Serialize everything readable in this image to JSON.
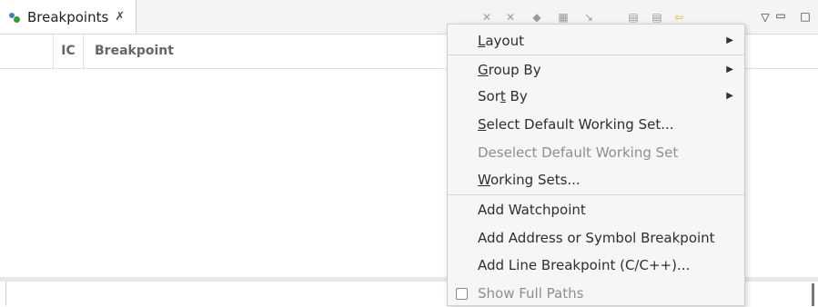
{
  "tab": {
    "label": "Breakpoints",
    "close": "✗"
  },
  "columns": {
    "ic": "IC",
    "breakpoint": "Breakpoint"
  },
  "menu": {
    "items": [
      {
        "pre": "",
        "mn": "L",
        "post": "ayout",
        "submenu": true
      },
      {
        "pre": "",
        "mn": "G",
        "post": "roup By",
        "submenu": true
      },
      {
        "pre": "Sor",
        "mn": "t",
        "post": " By",
        "submenu": true
      },
      {
        "pre": "",
        "mn": "S",
        "post": "elect Default Working Set...",
        "submenu": false
      },
      {
        "label": "Deselect Default Working Set",
        "disabled": true
      },
      {
        "pre": "",
        "mn": "W",
        "post": "orking Sets...",
        "submenu": false
      },
      {
        "label": "Add Watchpoint"
      },
      {
        "label": "Add Address or Symbol Breakpoint"
      },
      {
        "label": "Add Line Breakpoint (C/C++)..."
      },
      {
        "label": "Show Full Paths",
        "checked": false
      }
    ]
  },
  "colors": {
    "menu_bg": "#f6f6f6",
    "accent": "#4a7fb8"
  }
}
